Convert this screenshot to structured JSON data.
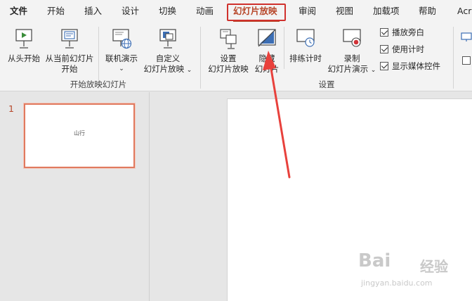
{
  "tabs": [
    {
      "label": "文件"
    },
    {
      "label": "开始"
    },
    {
      "label": "插入"
    },
    {
      "label": "设计"
    },
    {
      "label": "切换"
    },
    {
      "label": "动画"
    },
    {
      "label": "幻灯片放映"
    },
    {
      "label": "审阅"
    },
    {
      "label": "视图"
    },
    {
      "label": "加载项"
    },
    {
      "label": "帮助"
    },
    {
      "label": "Acr"
    }
  ],
  "active_tab": "幻灯片放映",
  "ribbon": {
    "start_group": {
      "label": "开始放映幻灯片",
      "from_beginning": "从头开始",
      "from_current_line1": "从当前幻灯片",
      "from_current_line2": "开始",
      "online_present": "联机演示",
      "custom_line1": "自定义",
      "custom_line2": "幻灯片放映"
    },
    "setup_group": {
      "label": "设置",
      "setup_line1": "设置",
      "setup_line2": "幻灯片放映",
      "hide_line1": "隐藏",
      "hide_line2": "幻灯片",
      "rehearse": "排练计时",
      "record_line1": "录制",
      "record_line2": "幻灯片演示",
      "play_narration": "播放旁白",
      "use_timings": "使用计时",
      "show_media_controls": "显示媒体控件"
    },
    "checkboxes": {
      "play_narration": true,
      "use_timings": true,
      "show_media_controls": true
    }
  },
  "slides": [
    {
      "number": "1",
      "text": "山行"
    }
  ],
  "watermark": {
    "logo": "Bai",
    "logo_suffix": "经验",
    "url": "jingyan.baidu.com"
  },
  "colors": {
    "accent": "#b7472a",
    "highlight_box": "#d0312d",
    "annotation_arrow": "#e8413c",
    "thumb_border": "#e07a5f"
  }
}
